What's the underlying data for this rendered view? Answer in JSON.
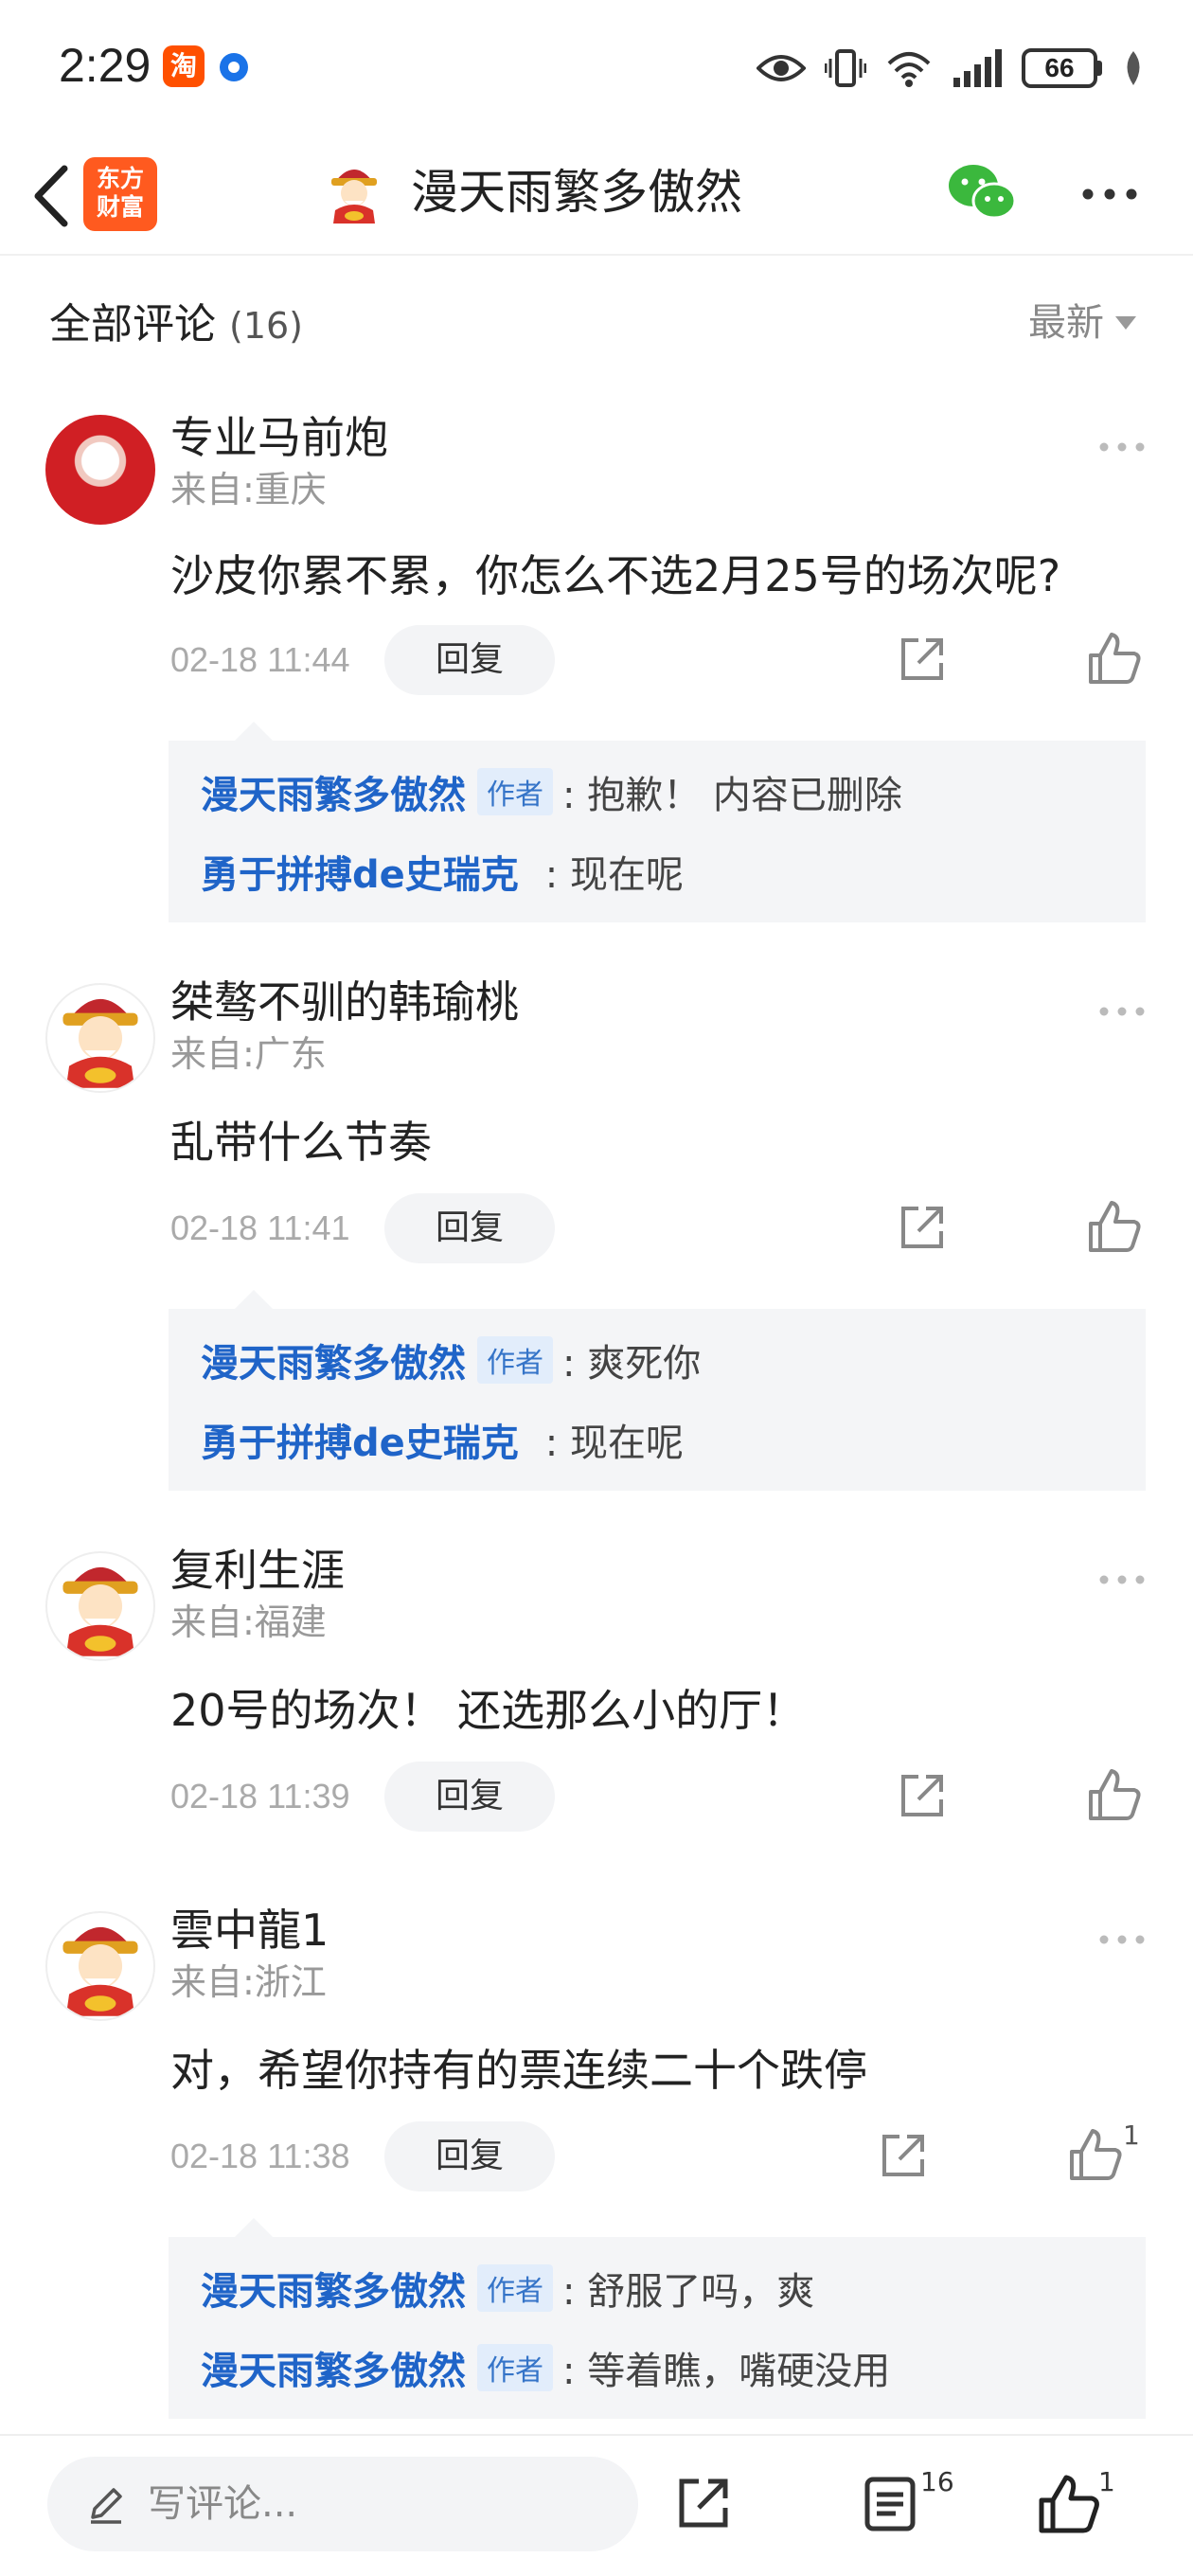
{
  "status_bar": {
    "time": "2:29",
    "taobao_badge": "淘",
    "battery": "66",
    "icons": [
      "taobao-icon",
      "circle-app-icon",
      "eye-icon",
      "vibrate-icon",
      "wifi-icon",
      "signal-icon",
      "battery-icon",
      "leaf-icon"
    ]
  },
  "nav": {
    "logo_line1": "东方",
    "logo_line2": "财富",
    "title": "漫天雨繁多傲然"
  },
  "section": {
    "title": "全部评论",
    "count": "(16)",
    "sort": "最新"
  },
  "comments": [
    {
      "username": "专业马前炮",
      "from": "来自:重庆",
      "content": "沙皮你累不累，你怎么不选2月25号的场次呢?",
      "date": "02-18 11:44",
      "reply_label": "回复",
      "replies": [
        {
          "name": "漫天雨繁多傲然",
          "tag": "作者",
          "text": ": 抱歉！ 内容已删除"
        },
        {
          "name": "勇于拼搏de史瑞克",
          "tag": "",
          "text": ": 现在呢"
        }
      ]
    },
    {
      "username": "桀骜不驯的韩瑜桃",
      "from": "来自:广东",
      "content": "乱带什么节奏",
      "date": "02-18 11:41",
      "reply_label": "回复",
      "replies": [
        {
          "name": "漫天雨繁多傲然",
          "tag": "作者",
          "text": ": 爽死你"
        },
        {
          "name": "勇于拼搏de史瑞克",
          "tag": "",
          "text": ": 现在呢"
        }
      ]
    },
    {
      "username": "复利生涯",
      "from": "来自:福建",
      "content": "20号的场次！ 还选那么小的厅！",
      "date": "02-18 11:39",
      "reply_label": "回复",
      "replies": []
    },
    {
      "username": "雲中龍1",
      "from": "来自:浙江",
      "content": "对，希望你持有的票连续二十个跌停",
      "date": "02-18 11:38",
      "reply_label": "回复",
      "like_count": "1",
      "replies": [
        {
          "name": "漫天雨繁多傲然",
          "tag": "作者",
          "text": ": 舒服了吗，爽"
        },
        {
          "name": "漫天雨繁多傲然",
          "tag": "作者",
          "text": ": 等着瞧，嘴硬没用"
        }
      ]
    }
  ],
  "bottom_bar": {
    "placeholder": "写评论...",
    "comment_count": "16",
    "like_count": "1"
  }
}
